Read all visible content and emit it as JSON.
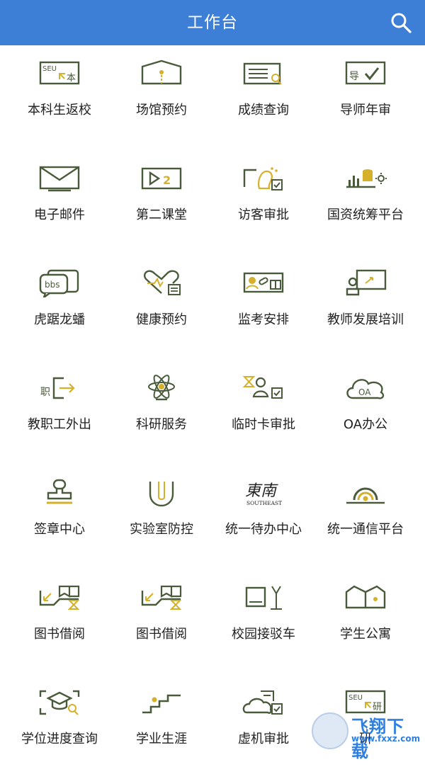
{
  "header": {
    "title": "工作台"
  },
  "icons": {
    "search": "search-icon"
  },
  "colors": {
    "header_bg": "#3d7fd6",
    "icon_green": "#4a5b3b",
    "icon_gold": "#d4b02b"
  },
  "apps": [
    {
      "label": "本科生返校",
      "icon": "seu-return-icon",
      "badge": "SEU",
      "badge_char": "本"
    },
    {
      "label": "场馆预约",
      "icon": "venue-icon"
    },
    {
      "label": "成绩查询",
      "icon": "grades-icon"
    },
    {
      "label": "导师年审",
      "icon": "tutor-review-icon",
      "badge_char": "导"
    },
    {
      "label": "电子邮件",
      "icon": "mail-icon"
    },
    {
      "label": "第二课堂",
      "icon": "second-class-icon",
      "badge_char": "2"
    },
    {
      "label": "访客审批",
      "icon": "visitor-icon"
    },
    {
      "label": "国资统筹平台",
      "icon": "assets-platform-icon"
    },
    {
      "label": "虎踞龙蟠",
      "icon": "bbs-icon",
      "badge": "bbs"
    },
    {
      "label": "健康预约",
      "icon": "health-icon"
    },
    {
      "label": "监考安排",
      "icon": "invigilation-icon"
    },
    {
      "label": "教师发展培训",
      "icon": "teacher-training-icon"
    },
    {
      "label": "教职工外出",
      "icon": "staff-out-icon",
      "badge_char": "职"
    },
    {
      "label": "科研服务",
      "icon": "research-icon"
    },
    {
      "label": "临时卡审批",
      "icon": "temp-card-icon"
    },
    {
      "label": "OA办公",
      "icon": "oa-cloud-icon",
      "badge": "OA"
    },
    {
      "label": "签章中心",
      "icon": "stamp-icon"
    },
    {
      "label": "实验室防控",
      "icon": "lab-icon"
    },
    {
      "label": "统一待办中心",
      "icon": "southeast-logo-icon",
      "badge": "SOUTHEAST",
      "badge_char": "東南"
    },
    {
      "label": "统一通信平台",
      "icon": "communication-icon"
    },
    {
      "label": "图书借阅",
      "icon": "library-icon"
    },
    {
      "label": "图书借阅",
      "icon": "library-icon"
    },
    {
      "label": "校园接驳车",
      "icon": "shuttle-icon"
    },
    {
      "label": "学生公寓",
      "icon": "dorm-icon"
    },
    {
      "label": "学位进度查询",
      "icon": "degree-progress-icon"
    },
    {
      "label": "学业生涯",
      "icon": "career-icon"
    },
    {
      "label": "虚机审批",
      "icon": "vm-approval-icon"
    },
    {
      "label": "研",
      "icon": "seu-grad-icon",
      "badge": "SEU",
      "badge_char": "研"
    }
  ],
  "watermark": {
    "text": "飞翔下载",
    "url": "www.fxxz.com"
  }
}
